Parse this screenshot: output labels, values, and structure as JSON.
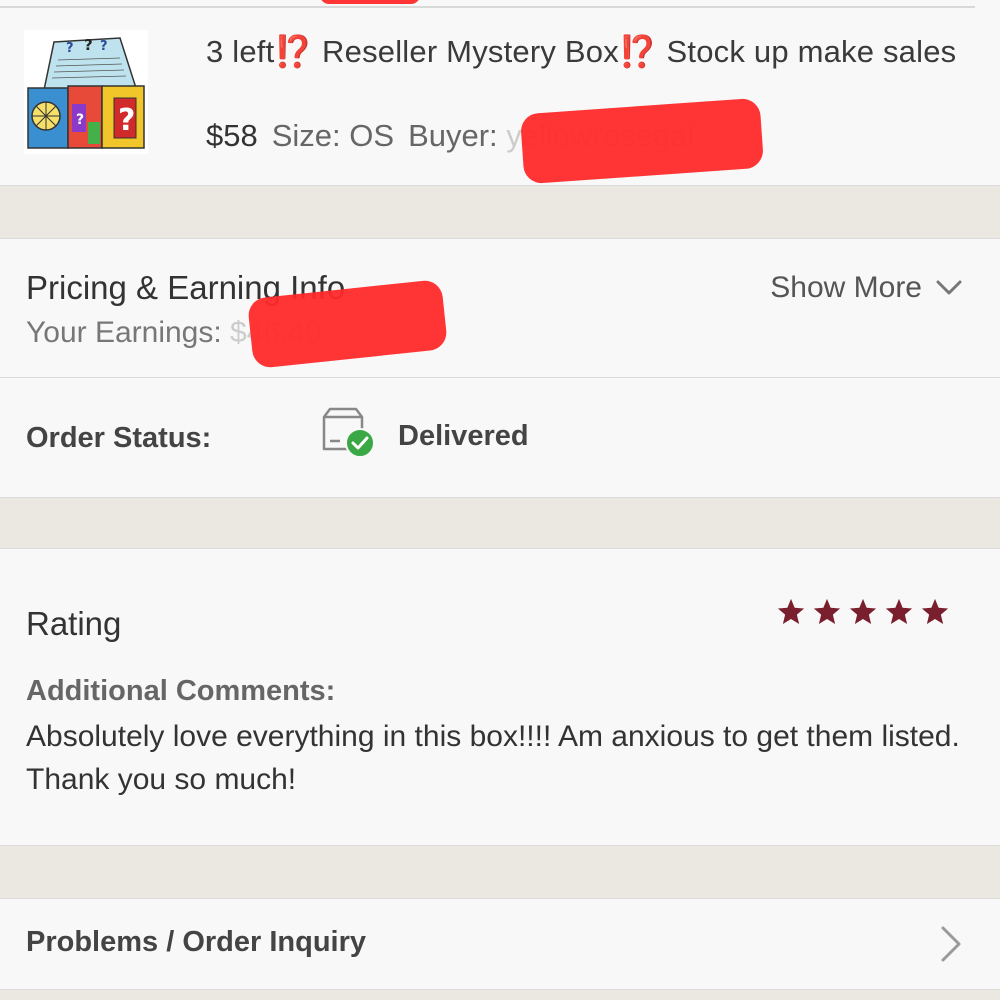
{
  "item": {
    "title_parts": [
      "3 left",
      "⁉️",
      " Reseller Mystery Box",
      "⁉️",
      " Stock up make sales"
    ],
    "price": "$58",
    "size_text": "Size: OS",
    "buyer_label": "Buyer:",
    "buyer_name": "yellowrosegal"
  },
  "pricing": {
    "title": "Pricing & Earning Info",
    "earnings_label": "Your Earnings:",
    "earnings_value": "$46.40",
    "show_more": "Show More",
    "show_more_icon": "chevron-down-icon"
  },
  "order_status": {
    "label": "Order Status:",
    "value": "Delivered",
    "icon": "package-delivered-icon",
    "status_color": "#3aa845"
  },
  "rating": {
    "title": "Rating",
    "stars": 5,
    "star_color": "#7a1f2e",
    "comments_label": "Additional Comments:",
    "comments_text": "Absolutely love everything in this box!!!! Am anxious to get them listed. Thank you so much!"
  },
  "problems": {
    "label": "Problems / Order Inquiry",
    "icon": "chevron-right-icon"
  },
  "redaction_color": "#ff2a2a"
}
